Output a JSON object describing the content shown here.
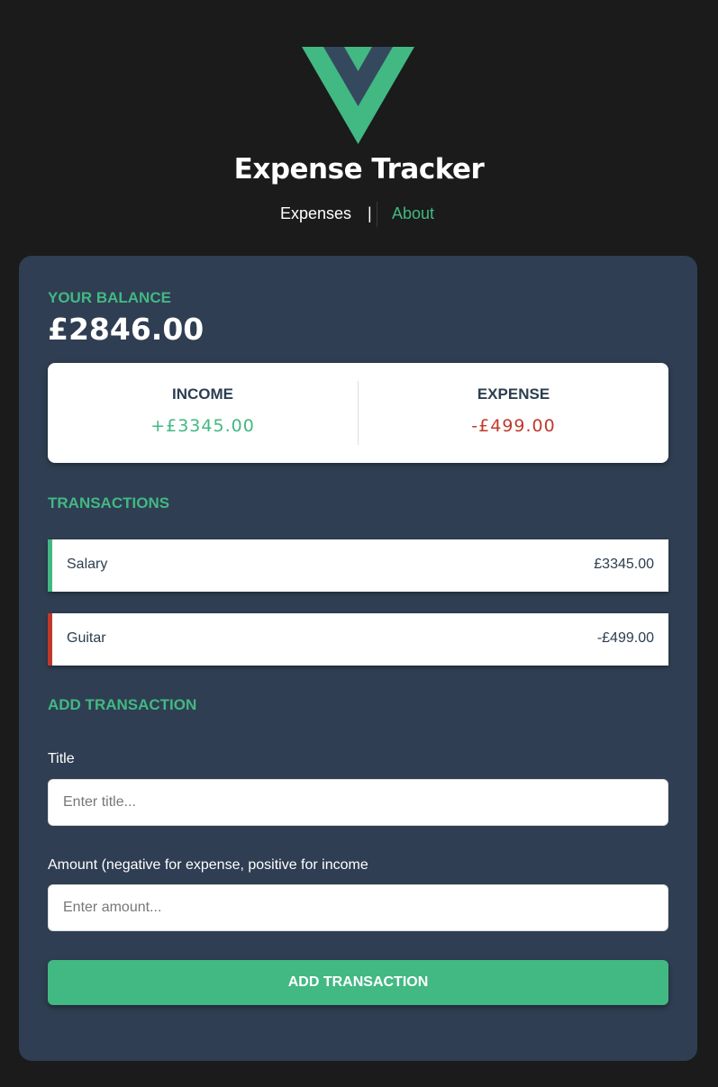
{
  "colors": {
    "page_bg": "#1b1b1b",
    "card_bg": "#2f3e52",
    "accent_green": "#42b883",
    "logo_dark": "#35495e",
    "expense_red": "#c0392b",
    "text_dark": "#2c3e50"
  },
  "header": {
    "logo_icon": "vue-logo-icon",
    "title": "Expense Tracker",
    "nav": {
      "expenses": "Expenses",
      "separator": "|",
      "about": "About"
    }
  },
  "balance": {
    "label": "YOUR BALANCE",
    "value": "£2846.00"
  },
  "summary": {
    "income_label": "INCOME",
    "income_value": "+£3345.00",
    "expense_label": "EXPENSE",
    "expense_value": "-£499.00"
  },
  "transactions": {
    "heading": "TRANSACTIONS",
    "items": [
      {
        "title": "Salary",
        "amount": "£3345.00",
        "type": "income"
      },
      {
        "title": "Guitar",
        "amount": "-£499.00",
        "type": "expense"
      }
    ]
  },
  "form": {
    "heading": "ADD TRANSACTION",
    "title_label": "Title",
    "title_placeholder": "Enter title...",
    "amount_label": "Amount (negative for expense, positive for income",
    "amount_placeholder": "Enter amount...",
    "submit_label": "ADD TRANSACTION"
  }
}
